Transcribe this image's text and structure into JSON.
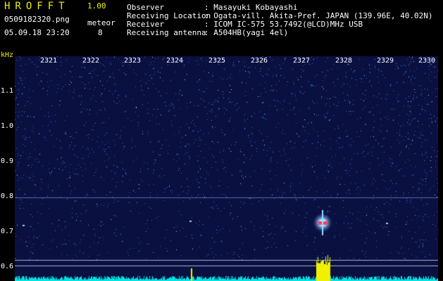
{
  "header": {
    "app_title": "HROFFT",
    "version": "1.00",
    "filename": "0509182320.png",
    "timestamp": "05.09.18 23:20",
    "detect_label": "meteor",
    "detect_count": "8",
    "info": [
      {
        "label": "Observer",
        "value": ": Masayuki Kobayashi"
      },
      {
        "label": "Receiving Location",
        "value": ": Ogata-vill. Akita-Pref. JAPAN (139.96E, 40.02N)"
      },
      {
        "label": "Receiver",
        "value": ": ICOM IC-575 53.7492(@LCD)MHz USB"
      },
      {
        "label": "Receiving antenna",
        "value": ": A504HB(yagi 4el)"
      }
    ]
  },
  "axis": {
    "freq_unit": "kHz",
    "y_ticks": [
      "1.1",
      "1.0",
      "0.9",
      "0.8",
      "0.7",
      "0.6"
    ],
    "x_ticks": [
      "2321",
      "2322",
      "2323",
      "2324",
      "2325",
      "2326",
      "2327",
      "2328",
      "2329",
      "2330"
    ]
  },
  "colors": {
    "label_yellow": "#f0f000",
    "label_white": "#ffffff",
    "spectrum_bg": "#0a1040",
    "noise": "#2f5fd0",
    "meteor_head": "#ff4060",
    "power_plot": "#00e5e5",
    "power_peak": "#f0f000"
  }
}
